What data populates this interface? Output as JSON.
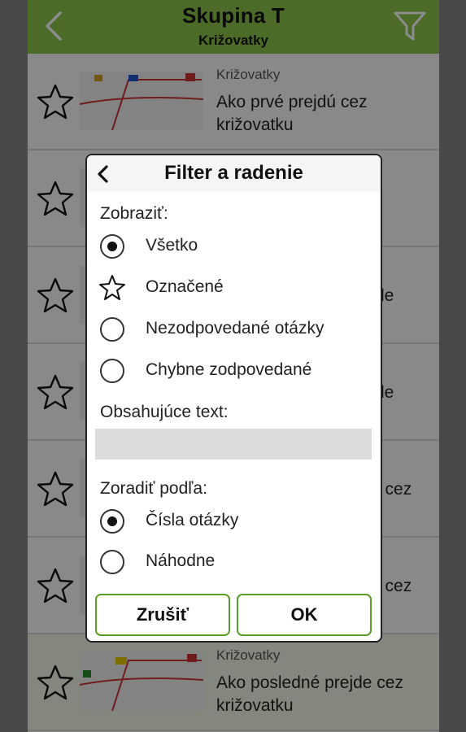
{
  "header": {
    "title": "Skupina T",
    "subtitle": "Križovatky"
  },
  "list": {
    "rows": [
      {
        "category": "Križovatky",
        "question": "Ako prvé prejdú cez križovatku"
      },
      {
        "category": "",
        "question": ""
      },
      {
        "category": "",
        "question": "le"
      },
      {
        "category": "",
        "question": "le"
      },
      {
        "category": "",
        "question": "e cez"
      },
      {
        "category": "",
        "question": "e cez"
      },
      {
        "category": "Križovatky",
        "question": "Ako posledné prejde cez križovatku"
      }
    ]
  },
  "dialog": {
    "title": "Filter a radenie",
    "show_label": "Zobraziť:",
    "show_options": [
      "Všetko",
      "Označené",
      "Nezodpovedané otázky",
      "Chybne zodpovedané"
    ],
    "show_selected": "Všetko",
    "contains_label": "Obsahujúce text:",
    "contains_value": "",
    "sort_label": "Zoradiť podľa:",
    "sort_options": [
      "Čísla otázky",
      "Náhodne"
    ],
    "sort_selected": "Čísla otázky",
    "cancel_label": "Zrušiť",
    "ok_label": "OK"
  },
  "icons": {
    "back": "chevron-left-icon",
    "filter": "funnel-icon",
    "star": "star-outline-icon"
  },
  "colors": {
    "header_bg": "#8bc34a",
    "button_border": "#5a9e2a",
    "input_bg": "#dcdcdc"
  }
}
